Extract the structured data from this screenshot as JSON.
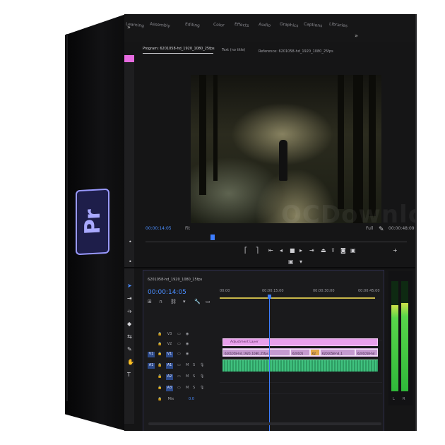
{
  "product": {
    "logo_text": "Pr"
  },
  "workspaces": {
    "expand_icon": "double-chevron-right-icon",
    "tabs": [
      "Learning",
      "Assembly",
      "Editing",
      "Color",
      "Effects",
      "Audio",
      "Graphics",
      "Captions",
      "Libraries"
    ],
    "overflow_icon": "double-chevron-right-icon"
  },
  "program_monitor": {
    "tabs": [
      {
        "label": "Program: 6201058-hd_1920_1080_25fps"
      },
      {
        "label": "Text (no title)"
      },
      {
        "label": "Reference: 6201058-hd_1920_1080_25fps"
      }
    ],
    "timecode_current": "00:00:14:05",
    "zoom": "Fit",
    "resolution": "Full",
    "timecode_duration": "00:00:48:09",
    "transport_icons": [
      "mark-in-icon",
      "mark-out-icon",
      "go-to-in-icon",
      "step-back-icon",
      "stop-icon",
      "play-icon",
      "step-forward-icon",
      "go-to-out-icon",
      "lift-icon",
      "extract-icon",
      "export-frame-icon",
      "comparison-view-icon"
    ],
    "watermark": "OCDownload"
  },
  "timeline": {
    "tab_label": "6201058-hd_1920_1080_25fps",
    "timecode": "00:00:14:05",
    "ruler": [
      "00:00",
      "00:00:15:00",
      "00:00:30:00",
      "00:00:45:00"
    ],
    "tracks": [
      {
        "id": "V3",
        "selected": false
      },
      {
        "id": "V2",
        "selected": false
      },
      {
        "id": "V1",
        "selected": true,
        "source": "V1"
      },
      {
        "id": "A1",
        "selected": true,
        "source": "A1"
      },
      {
        "id": "A2",
        "selected": false
      },
      {
        "id": "A3",
        "selected": false
      },
      {
        "id": "Mix",
        "selected": false,
        "value": "0.0"
      }
    ],
    "clips": {
      "adjustment": "Adjustment Layer",
      "video": [
        "6201058-hd_1920_1080_25fps",
        "620105",
        "62",
        "6201058-hd_1",
        "6201058-hd"
      ]
    }
  },
  "meters": {
    "left_label": "L",
    "right_label": "R",
    "left_level": 0.78,
    "right_level": 0.8
  },
  "tools": [
    "selection-tool-icon",
    "track-select-icon",
    "ripple-edit-icon",
    "razor-icon",
    "slip-icon",
    "pen-icon",
    "hand-icon",
    "type-icon"
  ]
}
